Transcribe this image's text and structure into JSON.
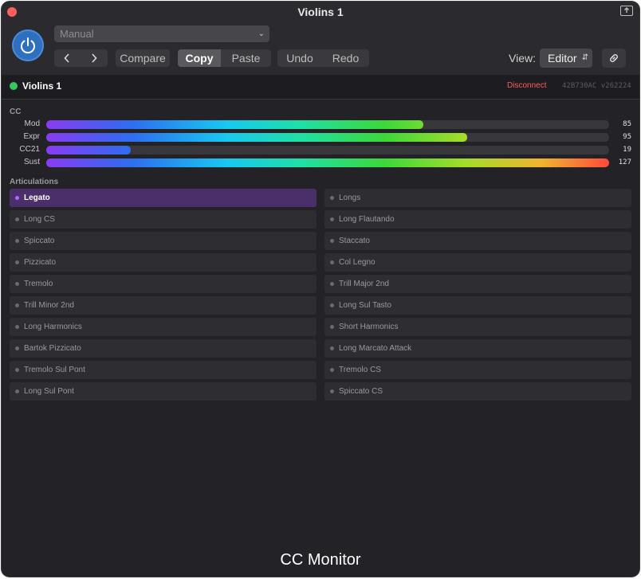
{
  "window": {
    "title": "Violins 1"
  },
  "toolbar": {
    "preset": "Manual",
    "compare_label": "Compare",
    "copy_label": "Copy",
    "paste_label": "Paste",
    "undo_label": "Undo",
    "redo_label": "Redo",
    "view_label": "View:",
    "view_value": "Editor"
  },
  "status": {
    "instrument": "Violins 1",
    "disconnect_label": "Disconnect",
    "build": "42B730AC v262224",
    "status_color": "#36c85a"
  },
  "cc": {
    "section_label": "CC",
    "max": 127,
    "rows": [
      {
        "label": "Mod",
        "value": 85
      },
      {
        "label": "Expr",
        "value": 95
      },
      {
        "label": "CC21",
        "value": 19
      },
      {
        "label": "Sust",
        "value": 127
      }
    ]
  },
  "articulations": {
    "section_label": "Articulations",
    "selected": "Legato",
    "accent_color": "#b068ff",
    "items": [
      "Legato",
      "Longs",
      "Long CS",
      "Long Flautando",
      "Spiccato",
      "Staccato",
      "Pizzicato",
      "Col Legno",
      "Tremolo",
      "Trill Major 2nd",
      "Trill Minor 2nd",
      "Long Sul Tasto",
      "Long Harmonics",
      "Short Harmonics",
      "Bartok Pizzicato",
      "Long Marcato Attack",
      "Tremolo Sul Pont",
      "Tremolo CS",
      "Long Sul Pont",
      "Spiccato CS"
    ]
  },
  "footer": {
    "title": "CC Monitor"
  }
}
